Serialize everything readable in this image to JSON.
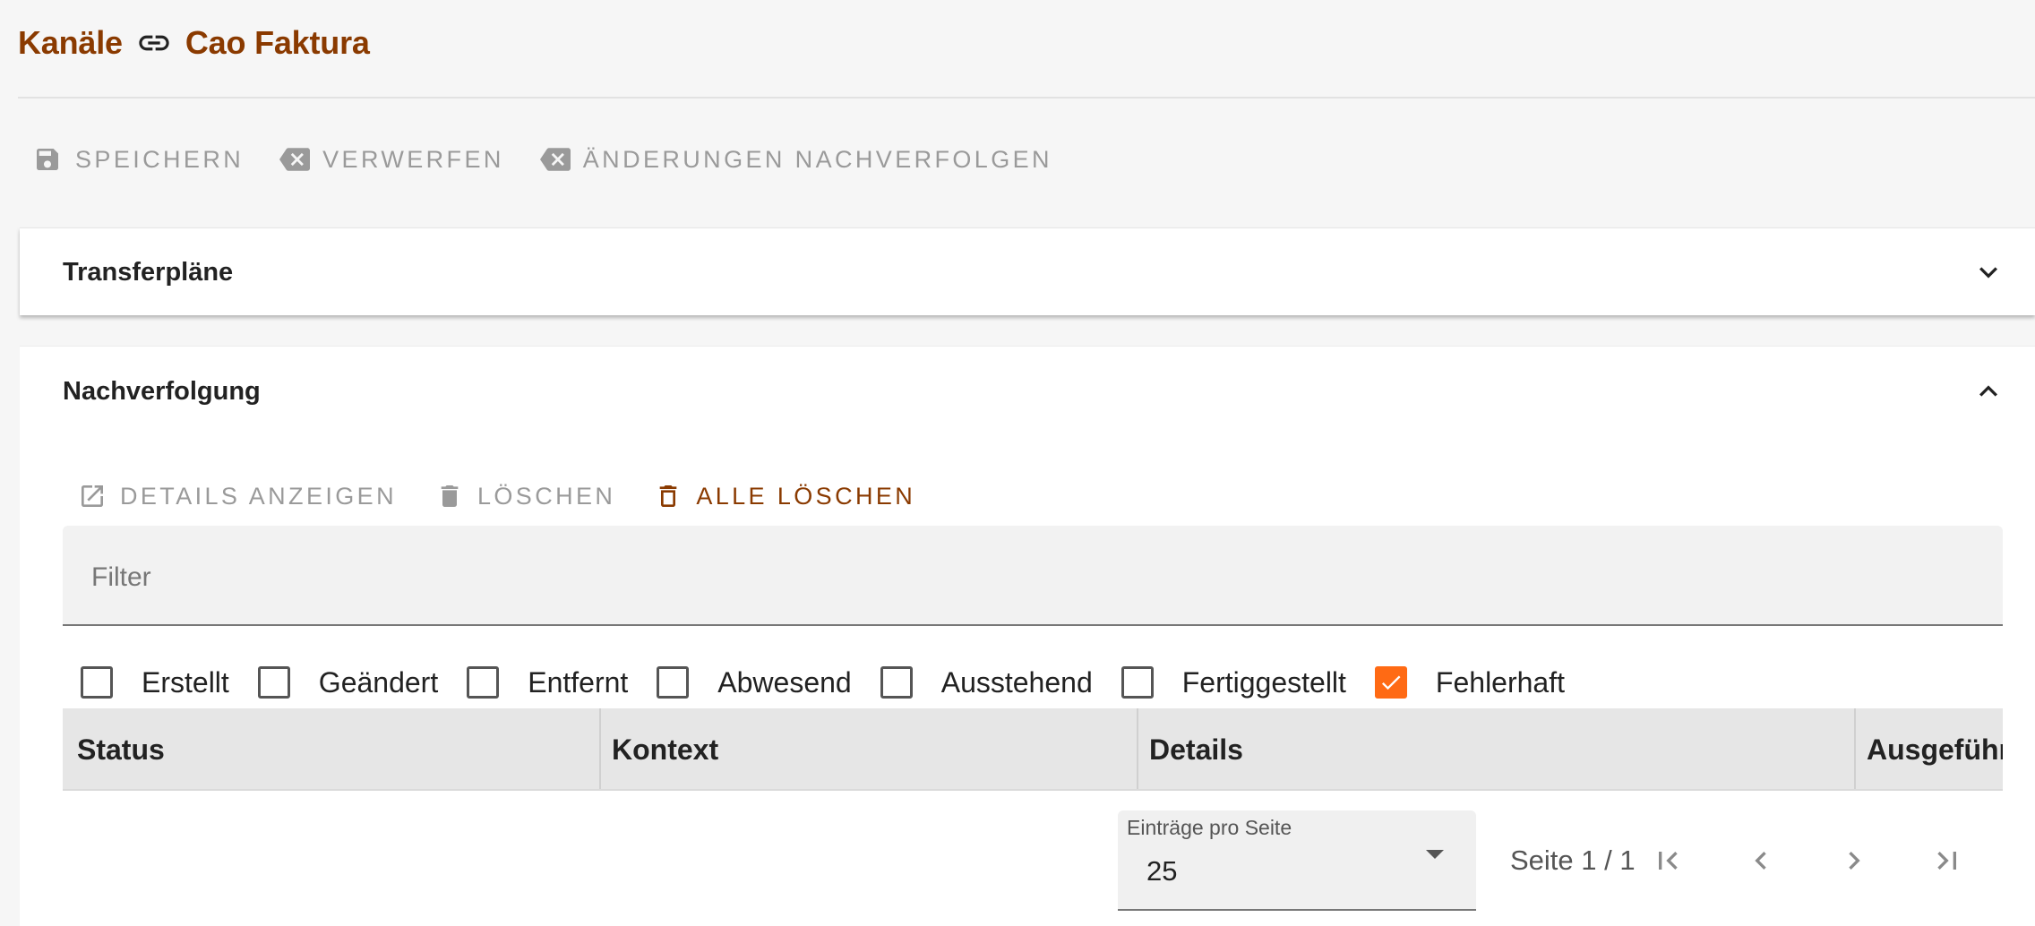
{
  "breadcrumb": {
    "parent": "Kanäle",
    "current": "Cao Faktura",
    "separator_icon": "link-icon"
  },
  "toolbar": {
    "save_label": "SPEICHERN",
    "discard_label": "VERWERFEN",
    "track_changes_label": "ÄNDERUNGEN NACHVERFOLGEN"
  },
  "panels": {
    "transfer_title": "Transferpläne",
    "tracking_title": "Nachverfolgung"
  },
  "tracking": {
    "toolbar": {
      "details_label": "DETAILS ANZEIGEN",
      "delete_label": "LÖSCHEN",
      "delete_all_label": "ALLE LÖSCHEN"
    },
    "filter": {
      "placeholder": "Filter",
      "value": ""
    },
    "status_filters": [
      {
        "label": "Erstellt",
        "checked": false
      },
      {
        "label": "Geändert",
        "checked": false
      },
      {
        "label": "Entfernt",
        "checked": false
      },
      {
        "label": "Abwesend",
        "checked": false
      },
      {
        "label": "Ausstehend",
        "checked": false
      },
      {
        "label": "Fertiggestellt",
        "checked": false
      },
      {
        "label": "Fehlerhaft",
        "checked": true
      }
    ],
    "table": {
      "columns": [
        "Status",
        "Kontext",
        "Details",
        "Ausgeführt"
      ]
    },
    "pagination": {
      "per_page_label": "Einträge pro Seite",
      "per_page_value": "25",
      "page_info": "Seite 1 / 1"
    }
  },
  "colors": {
    "accent_brown": "#8a3a00",
    "checkbox_orange": "#ff6a14",
    "disabled_gray": "#9a9a9a"
  }
}
